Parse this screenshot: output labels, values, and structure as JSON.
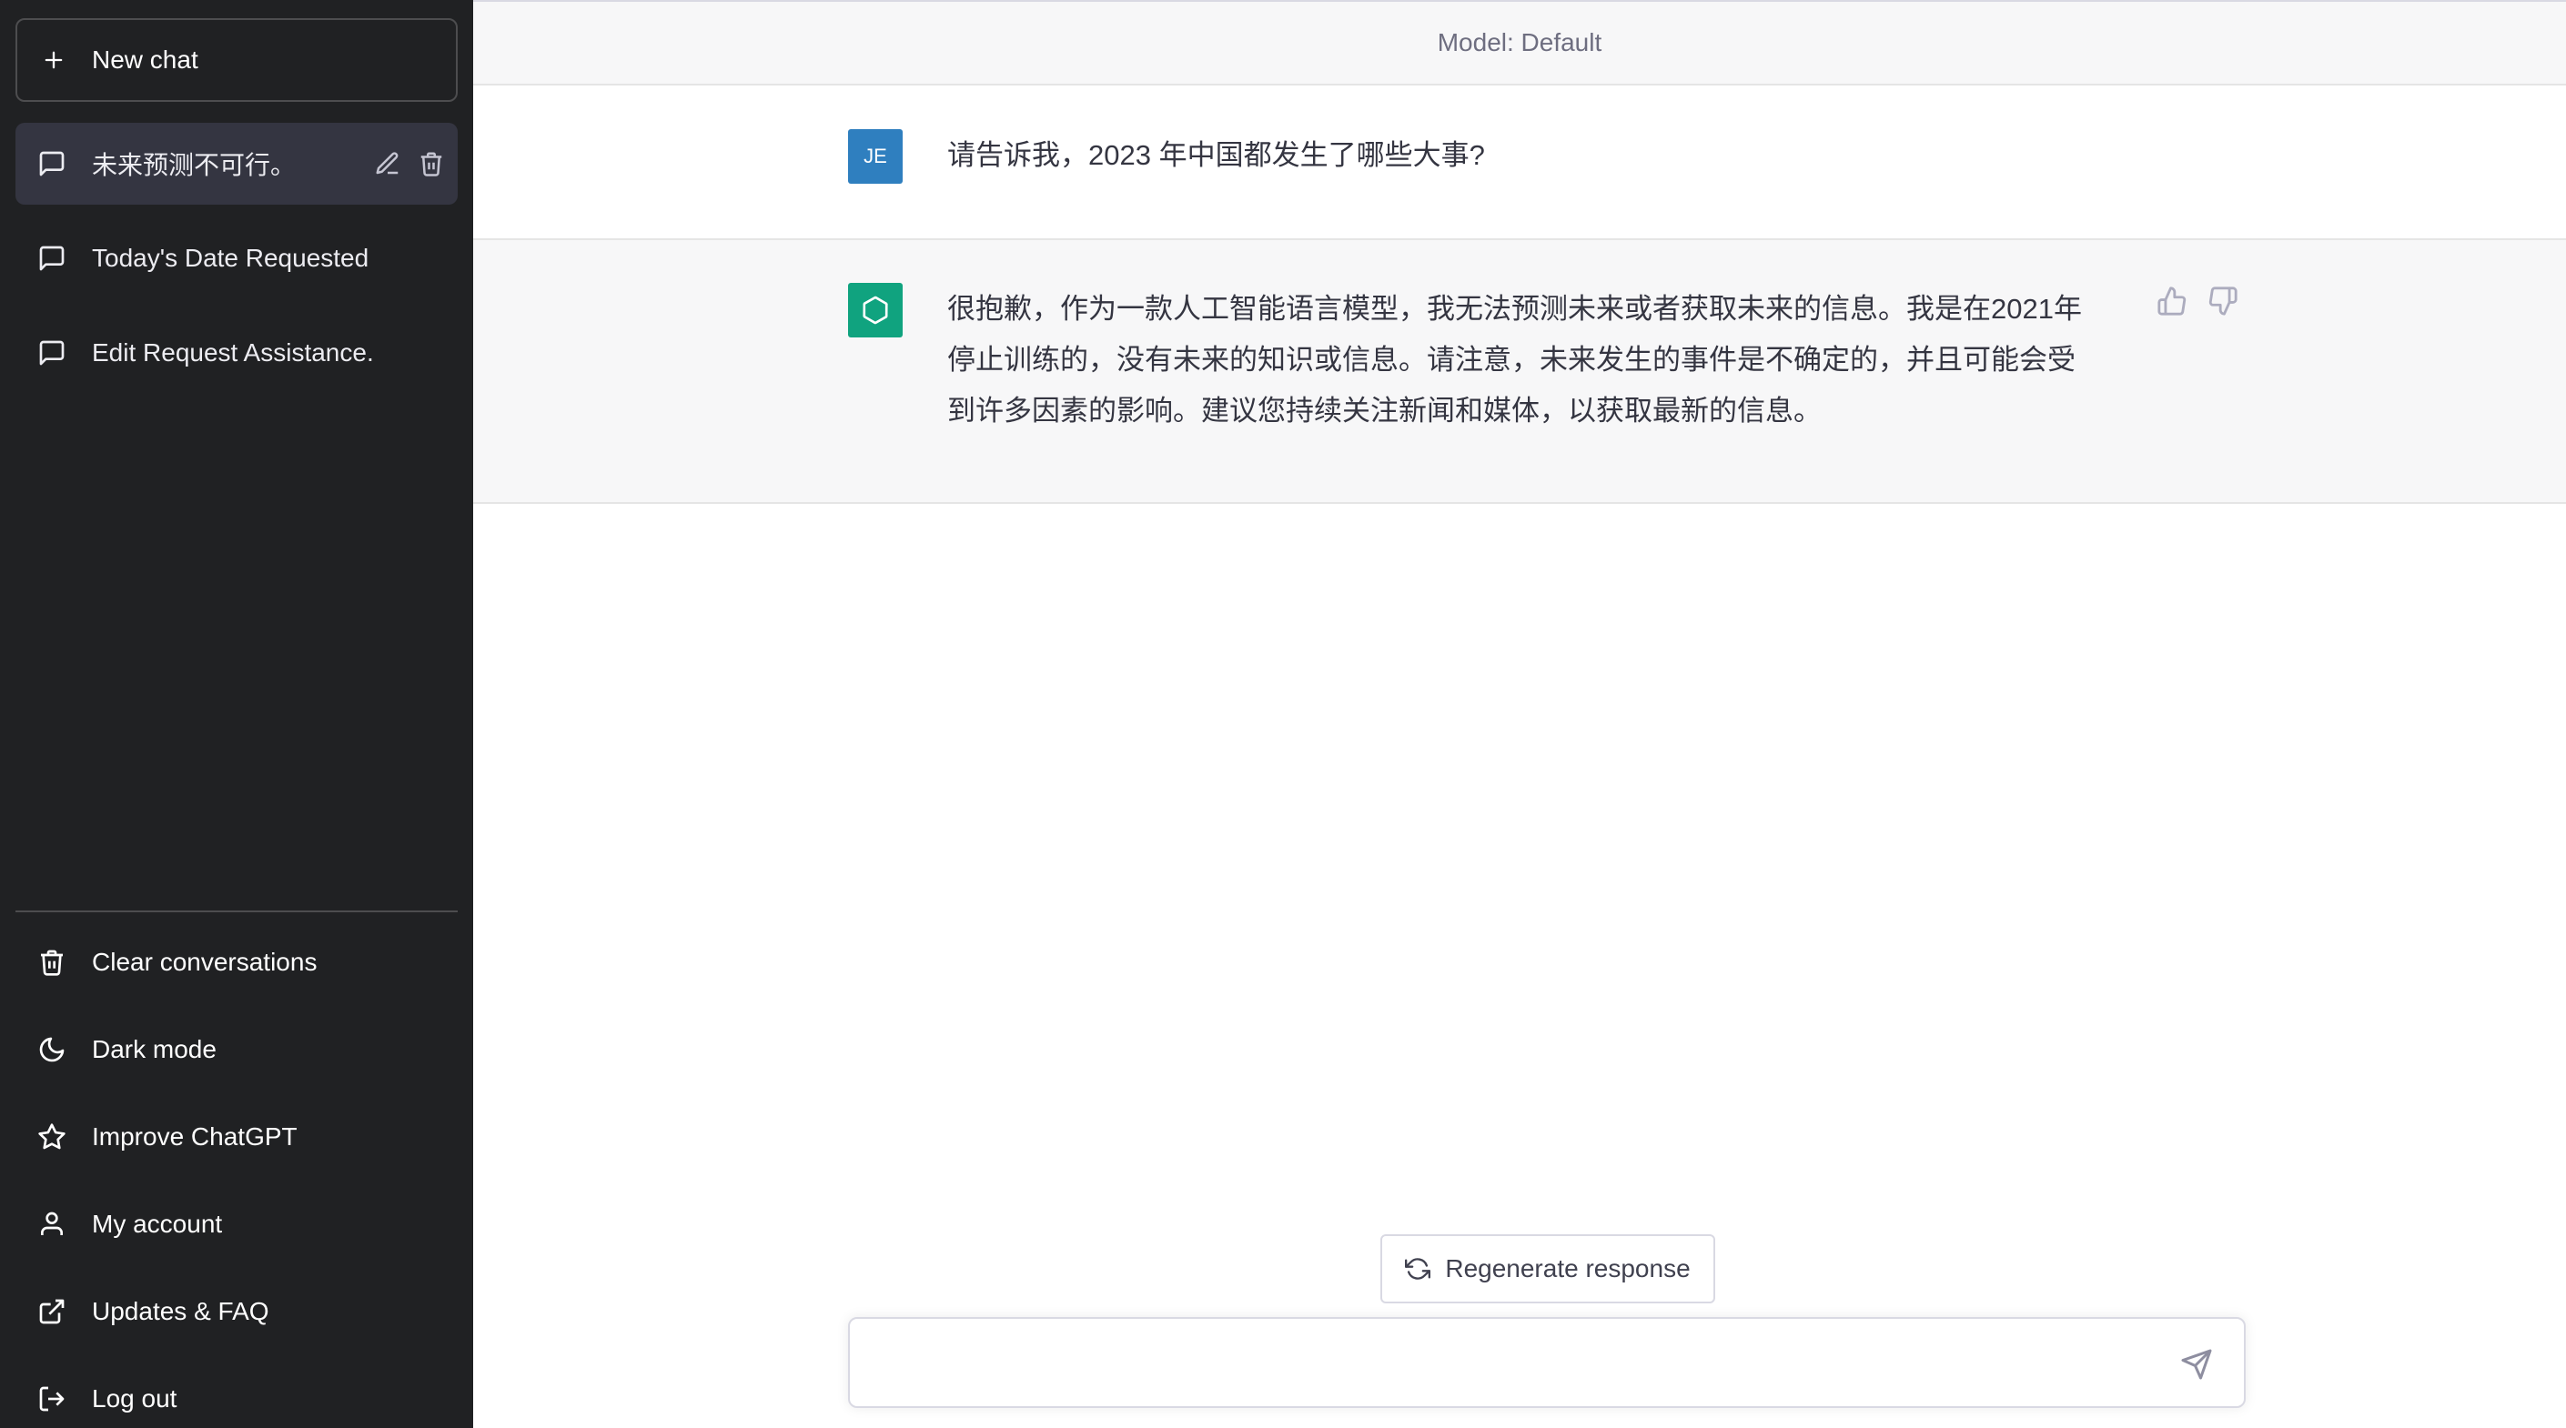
{
  "sidebar": {
    "new_chat_label": "New chat",
    "conversations": [
      {
        "title": "未来预测不可行。",
        "active": true
      },
      {
        "title": "Today's Date Requested",
        "active": false
      },
      {
        "title": "Edit Request Assistance.",
        "active": false
      }
    ],
    "bottom_items": [
      {
        "label": "Clear conversations",
        "icon": "trash-icon"
      },
      {
        "label": "Dark mode",
        "icon": "moon-icon"
      },
      {
        "label": "Improve ChatGPT",
        "icon": "star-icon"
      },
      {
        "label": "My account",
        "icon": "user-icon"
      },
      {
        "label": "Updates & FAQ",
        "icon": "external-link-icon"
      },
      {
        "label": "Log out",
        "icon": "logout-icon"
      }
    ]
  },
  "main": {
    "model_label": "Model: Default",
    "messages": [
      {
        "role": "user",
        "avatar_text": "JE",
        "text": "请告诉我，2023 年中国都发生了哪些大事?"
      },
      {
        "role": "assistant",
        "text_lines": [
          "很抱歉，作为一款人工智能语言模型，我无法预测未来或者获取未来的信息。我是在2021年",
          "停止训练的，没有未来的知识或信息。请注意，未来发生的事件是不确定的，并且可能会受",
          "到许多因素的影响。建议您持续关注新闻和媒体，以获取最新的信息。"
        ]
      }
    ],
    "regenerate_label": "Regenerate response",
    "input_value": "",
    "input_placeholder": ""
  },
  "colors": {
    "sidebar_bg": "#202123",
    "active_item_bg": "#343541",
    "user_avatar": "#2f7fbf",
    "assistant_avatar": "#10a37f",
    "assistant_msg_bg": "#f7f7f8"
  }
}
